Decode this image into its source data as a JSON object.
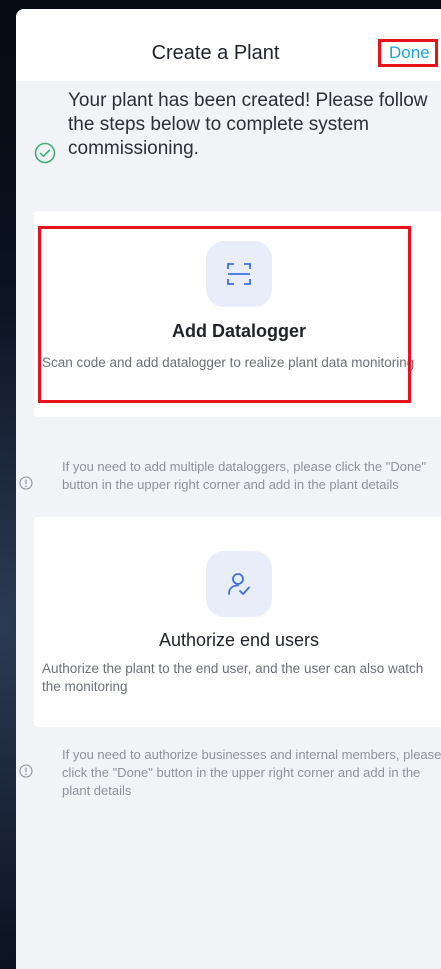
{
  "header": {
    "title": "Create a Plant",
    "done_label": "Done"
  },
  "success": {
    "message": "Your plant has been created! Please follow the steps below to complete system commissioning."
  },
  "cards": [
    {
      "title": "Add Datalogger",
      "description": "Scan code and add datalogger to realize plant data monitoring",
      "icon": "scan-icon"
    },
    {
      "title": "Authorize end users",
      "description": "Authorize the plant to the end user, and the user can also watch the monitoring",
      "icon": "user-check-icon"
    }
  ],
  "notes": [
    "If you need to add multiple dataloggers, please click the \"Done\" button in the upper right corner and add in the plant details",
    "If you need to authorize businesses and internal members, please click the \"Done\" button in the upper right corner and add in the plant details"
  ],
  "colors": {
    "accent": "#19a3e6",
    "success": "#3cb371",
    "highlight": "#e8121c",
    "icon_tile": "#e9edfa"
  }
}
